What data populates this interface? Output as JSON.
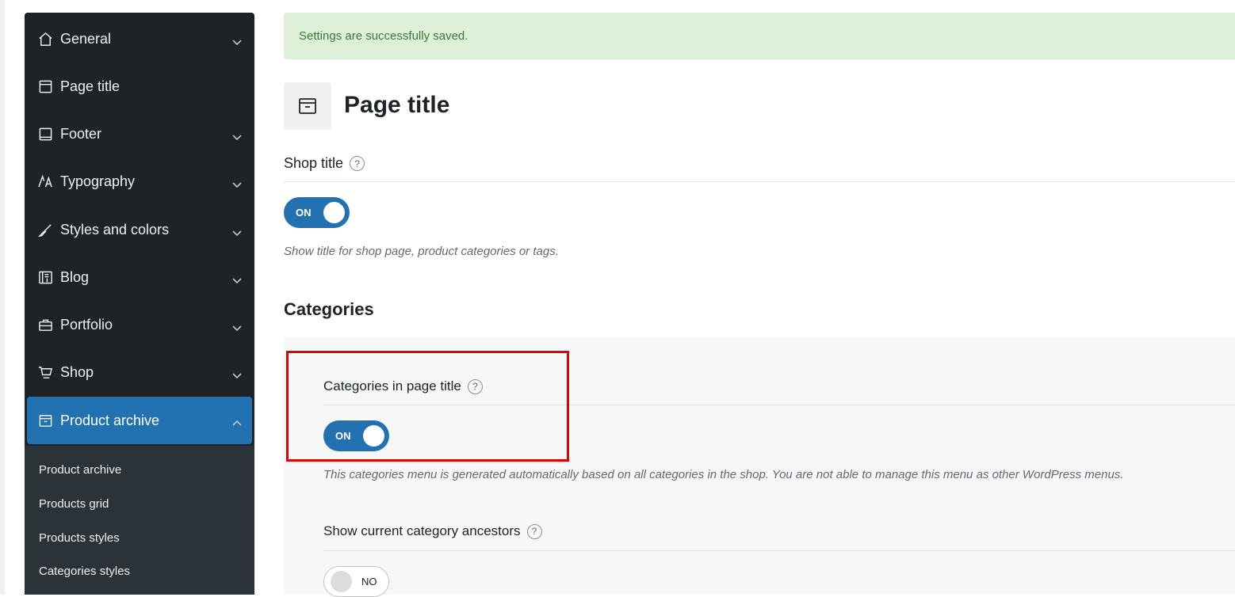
{
  "sidebar": {
    "items": [
      {
        "label": "General",
        "icon": "home-icon",
        "expandable": true
      },
      {
        "label": "Page title",
        "icon": "window-icon",
        "expandable": false
      },
      {
        "label": "Footer",
        "icon": "footer-icon",
        "expandable": true
      },
      {
        "label": "Typography",
        "icon": "typography-icon",
        "expandable": true
      },
      {
        "label": "Styles and colors",
        "icon": "brush-icon",
        "expandable": true
      },
      {
        "label": "Blog",
        "icon": "blog-icon",
        "expandable": true
      },
      {
        "label": "Portfolio",
        "icon": "briefcase-icon",
        "expandable": true
      },
      {
        "label": "Shop",
        "icon": "cart-icon",
        "expandable": true
      },
      {
        "label": "Product archive",
        "icon": "archive-icon",
        "expandable": true,
        "active": true
      }
    ],
    "submenu": [
      "Product archive",
      "Products grid",
      "Products styles",
      "Categories styles"
    ]
  },
  "notice": {
    "text": "Settings are successfully saved."
  },
  "page": {
    "title": "Page title",
    "icon": "archive-icon"
  },
  "shop_title": {
    "label": "Shop title",
    "help": "?",
    "toggle": "ON",
    "description": "Show title for shop page, product categories or tags."
  },
  "categories": {
    "title": "Categories",
    "in_page_title": {
      "label": "Categories in page title",
      "help": "?",
      "toggle": "ON",
      "description": "This categories menu is generated automatically based on all categories in the shop. You are not able to manage this menu as other WordPress menus."
    },
    "ancestors": {
      "label": "Show current category ancestors",
      "help": "?",
      "toggle": "NO"
    }
  },
  "colors": {
    "accent": "#2271b1",
    "sidebar": "#1d2327",
    "notice_bg": "#dff0d8",
    "highlight": "#e00000"
  }
}
